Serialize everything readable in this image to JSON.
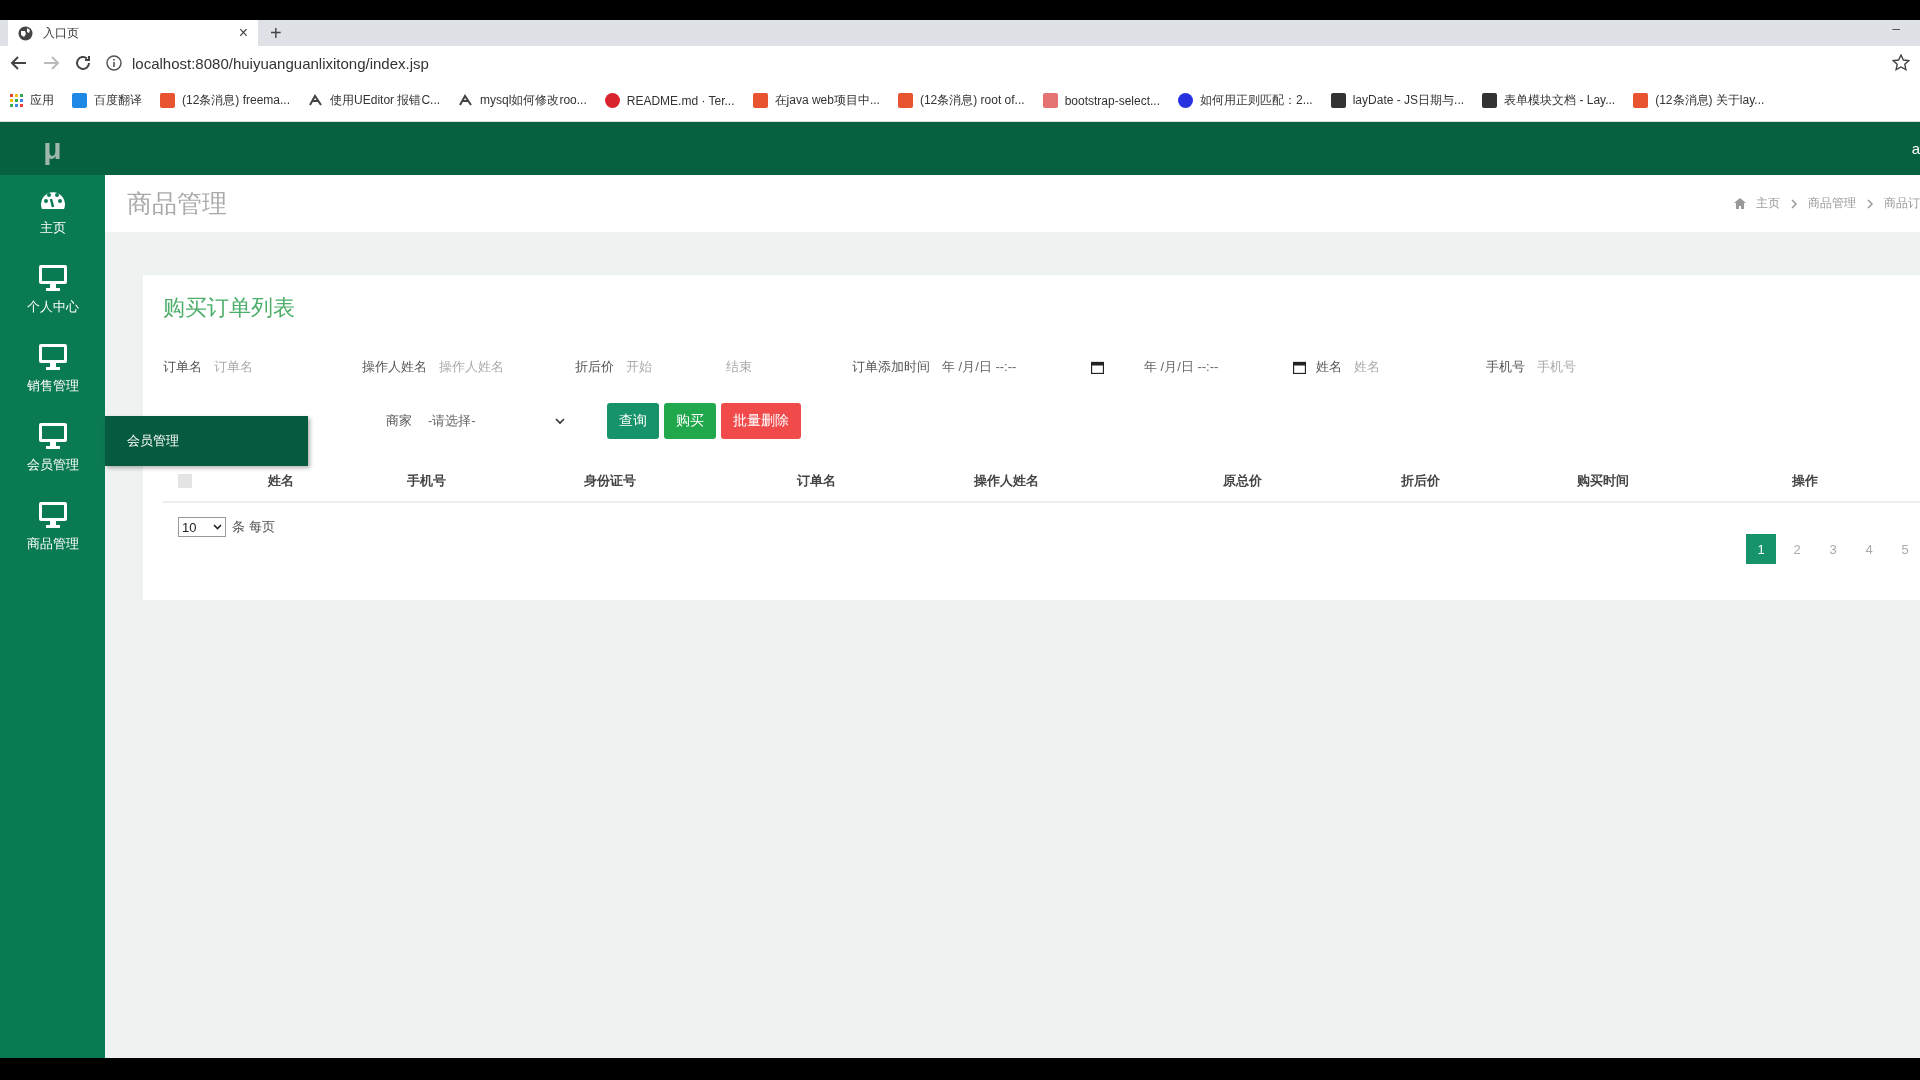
{
  "browser": {
    "tab": {
      "title": "入口页",
      "close": "×"
    },
    "new_tab": "+",
    "window_control": "–",
    "address": "localhost:8080/huiyuanguanlixitong/index.jsp",
    "bookmarks": [
      {
        "kind": "apps",
        "label": "应用"
      },
      {
        "kind": "square",
        "color": "#1e88e5",
        "label": "百度翻译"
      },
      {
        "kind": "square",
        "color": "#e8542f",
        "label": "(12条消息) freema..."
      },
      {
        "kind": "glyph",
        "color": "#444444",
        "label": "使用UEditor 报错C..."
      },
      {
        "kind": "glyph",
        "color": "#444444",
        "label": "mysql如何修改roo..."
      },
      {
        "kind": "circle",
        "color": "#d9232d",
        "label": "README.md · Ter..."
      },
      {
        "kind": "square",
        "color": "#e8542f",
        "label": "在java web项目中..."
      },
      {
        "kind": "square",
        "color": "#e8542f",
        "label": "(12条消息) root of..."
      },
      {
        "kind": "square",
        "color": "#e57373",
        "label": "bootstrap-select..."
      },
      {
        "kind": "circle",
        "color": "#2932e1",
        "label": "如何用正则匹配：2..."
      },
      {
        "kind": "square",
        "color": "#333333",
        "label": "layDate - JS日期与..."
      },
      {
        "kind": "square",
        "color": "#333333",
        "label": "表单模块文档 - Lay..."
      },
      {
        "kind": "square",
        "color": "#e8542f",
        "label": "(12条消息) 关于lay..."
      }
    ]
  },
  "app": {
    "logo": "μ",
    "header_right": "a",
    "sidebar": {
      "items": [
        {
          "kind": "gauge",
          "label": "主页"
        },
        {
          "kind": "monitor",
          "label": "个人中心"
        },
        {
          "kind": "monitor",
          "label": "销售管理"
        },
        {
          "kind": "monitor",
          "label": "会员管理"
        },
        {
          "kind": "monitor",
          "label": "商品管理"
        }
      ]
    },
    "flyout": {
      "label": "会员管理"
    },
    "page_title": "商品管理",
    "breadcrumb": [
      "主页",
      "商品管理",
      "商品订"
    ],
    "card": {
      "title": "购买订单列表",
      "filters": [
        {
          "kind": "text",
          "label": "订单名",
          "placeholder": "订单名"
        },
        {
          "kind": "text",
          "label": "操作人姓名",
          "placeholder": "操作人姓名"
        },
        {
          "kind": "range",
          "label": "折后价",
          "placeholders": [
            "开始",
            "结束"
          ]
        },
        {
          "kind": "daterange",
          "label": "订单添加时间",
          "values": [
            "年 /月/日 --:--",
            "年 /月/日 --:--"
          ]
        },
        {
          "kind": "text",
          "label": "姓名",
          "placeholder": "姓名"
        },
        {
          "kind": "text",
          "label": "手机号",
          "placeholder": "手机号"
        }
      ],
      "select": {
        "label": "商家",
        "value": "-请选择-"
      },
      "buttons": [
        {
          "kind": "query",
          "label": "查询"
        },
        {
          "kind": "buy",
          "label": "购买"
        },
        {
          "kind": "delete",
          "label": "批量删除"
        }
      ],
      "table": {
        "checked": false,
        "columns": [
          "姓名",
          "手机号",
          "身份证号",
          "订单名",
          "操作人姓名",
          "原总价",
          "折后价",
          "购买时间",
          "操作"
        ]
      },
      "page_size": {
        "value": "10",
        "suffix": "条 每页"
      },
      "pages": [
        {
          "label": "1",
          "selected": true
        },
        {
          "label": "2",
          "selected": false
        },
        {
          "label": "3",
          "selected": false
        },
        {
          "label": "4",
          "selected": false
        },
        {
          "label": "5",
          "selected": false
        }
      ]
    }
  }
}
